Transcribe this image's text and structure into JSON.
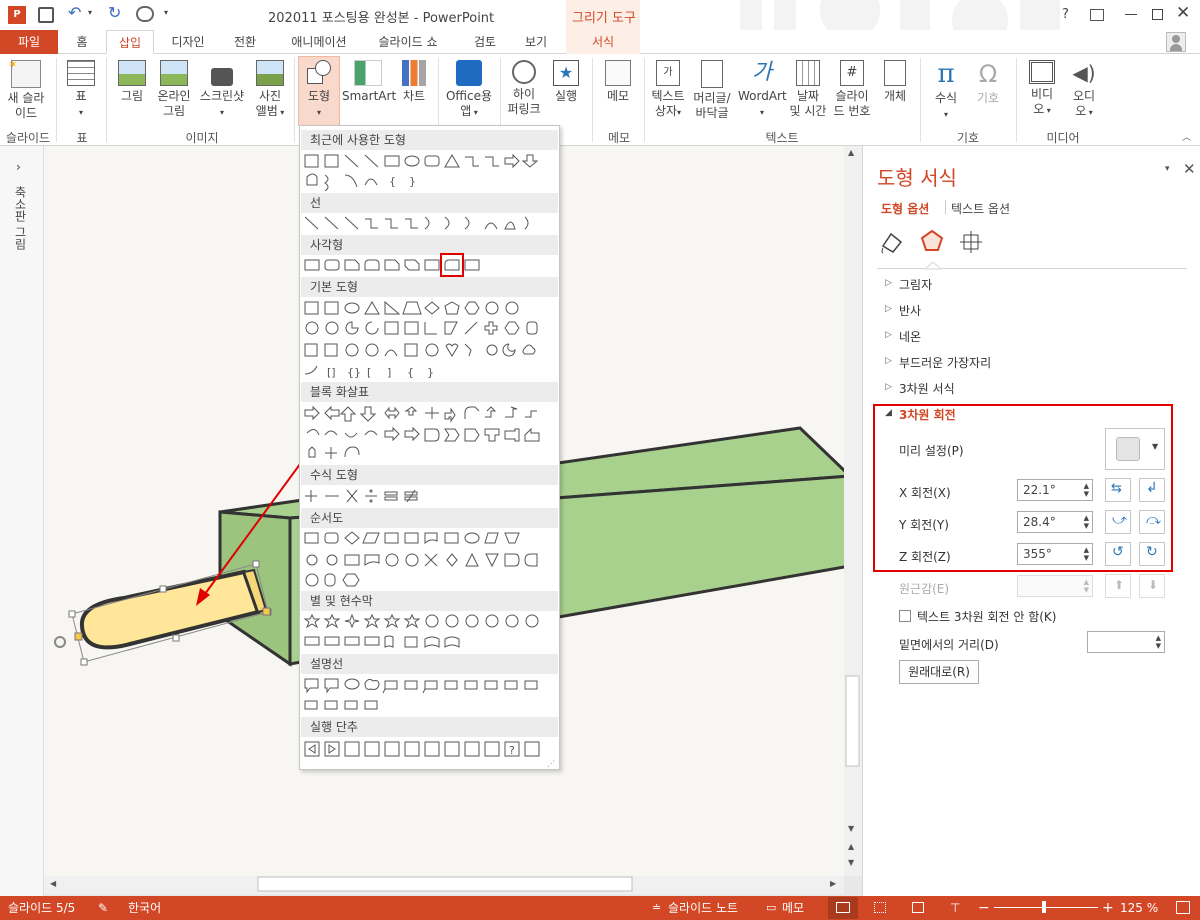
{
  "window": {
    "title": "202011 포스팅용 완성본 - PowerPoint",
    "context_tab_group": "그리기 도구",
    "help": "?"
  },
  "tabs": [
    "파일",
    "홈",
    "삽입",
    "디자인",
    "전환",
    "애니메이션",
    "슬라이드 쇼",
    "검토",
    "보기",
    "서식"
  ],
  "ribbon": {
    "new_slide": "새 슬라\n이드",
    "table": "표",
    "picture": "그림",
    "online_picture": "온라인\n그림",
    "screenshot": "스크린샷",
    "photo_album": "사진\n앨범",
    "shapes": "도형",
    "smartart": "SmartArt",
    "chart": "차트",
    "office_apps": "Office용\n앱",
    "hyperlink": "하이\n퍼링크",
    "action": "실행",
    "comment": "메모",
    "textbox": "텍스트\n상자",
    "header_footer": "머리글/\n바닥글",
    "wordart": "WordArt",
    "date_time": "날짜\n및 시간",
    "slide_number": "슬라이\n드 번호",
    "object": "개체",
    "equation": "수식",
    "symbol": "기호",
    "video": "비디\n오",
    "audio": "오디\n오",
    "groups": {
      "slides": "슬라이드",
      "tables": "표",
      "images": "이미지",
      "comments": "메모",
      "text": "텍스트",
      "symbols": "기호",
      "media": "미디어"
    }
  },
  "left_panel": {
    "label": "축소판 그림"
  },
  "shapes_gallery": {
    "categories": [
      "최근에 사용한 도형",
      "선",
      "사각형",
      "기본 도형",
      "블록 화살표",
      "수식 도형",
      "순서도",
      "별 및 현수막",
      "설명선",
      "실행 단추"
    ]
  },
  "format_pane": {
    "title": "도형 서식",
    "tab_shape": "도형 옵션",
    "tab_text": "텍스트 옵션",
    "sections": [
      "그림자",
      "반사",
      "네온",
      "부드러운 가장자리",
      "3차원 서식"
    ],
    "rotation_section": "3차원 회전",
    "preset_label": "미리 설정(P)",
    "x_label": "X 회전(X)",
    "x_value": "22.1°",
    "y_label": "Y 회전(Y)",
    "y_value": "28.4°",
    "z_label": "Z 회전(Z)",
    "z_value": "355°",
    "perspective_label": "원근감(E)",
    "keep_text_flat": "텍스트 3차원 회전 안 함(K)",
    "distance_label": "밑면에서의 거리(D)",
    "reset_label": "원래대로(R)"
  },
  "status": {
    "slide": "슬라이드 5/5",
    "language": "한국어",
    "notes": "슬라이드 노트",
    "comments": "메모",
    "zoom": "125 %"
  },
  "colors": {
    "accent": "#d24726",
    "shape_green": "#a9d18e",
    "shape_yellow": "#ffe699",
    "highlight_red": "#e00000"
  }
}
